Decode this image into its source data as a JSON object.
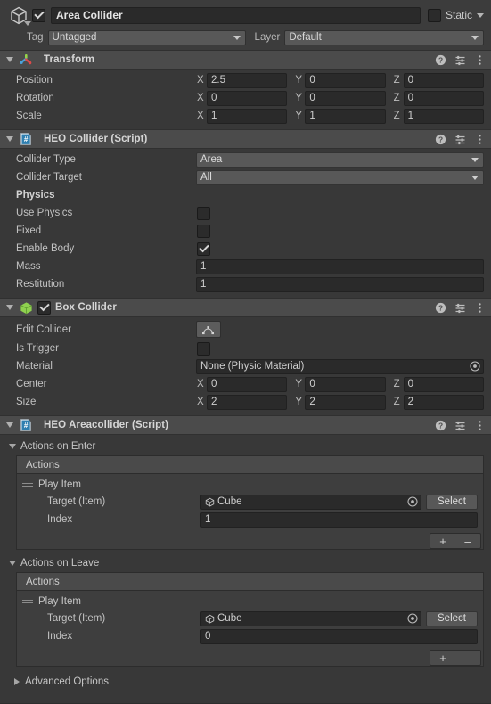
{
  "gameobject": {
    "icon": "cube-gameobject-icon",
    "enabled": true,
    "name": "Area Collider",
    "static_label": "Static",
    "tag_label": "Tag",
    "tag_value": "Untagged",
    "layer_label": "Layer",
    "layer_value": "Default"
  },
  "components": [
    {
      "title": "Transform",
      "icon": "transform-axis-icon",
      "rows": [
        {
          "label": "Position",
          "type": "vector3",
          "x": "2.5",
          "y": "0",
          "z": "0"
        },
        {
          "label": "Rotation",
          "type": "vector3",
          "x": "0",
          "y": "0",
          "z": "0"
        },
        {
          "label": "Scale",
          "type": "vector3",
          "x": "1",
          "y": "1",
          "z": "1"
        }
      ]
    },
    {
      "title": "HEO Collider (Script)",
      "icon": "csharp-script-icon",
      "rows": [
        {
          "label": "Collider Type",
          "type": "dropdown",
          "value": "Area"
        },
        {
          "label": "Collider Target",
          "type": "dropdown",
          "value": "All"
        },
        {
          "label": "Physics",
          "type": "header"
        },
        {
          "label": "Use Physics",
          "type": "checkbox",
          "checked": false
        },
        {
          "label": "Fixed",
          "type": "checkbox",
          "checked": false
        },
        {
          "label": "Enable Body",
          "type": "checkbox",
          "checked": true
        },
        {
          "label": "Mass",
          "type": "text",
          "value": "1"
        },
        {
          "label": "Restitution",
          "type": "text",
          "value": "1"
        }
      ]
    },
    {
      "title": "Box Collider",
      "icon": "box-collider-icon",
      "enabled": true,
      "rows": [
        {
          "label": "Edit Collider",
          "type": "editbutton"
        },
        {
          "label": "Is Trigger",
          "type": "checkbox",
          "checked": false
        },
        {
          "label": "Material",
          "type": "object",
          "value": "None (Physic Material)"
        },
        {
          "label": "Center",
          "type": "vector3",
          "x": "0",
          "y": "0",
          "z": "0"
        },
        {
          "label": "Size",
          "type": "vector3",
          "x": "2",
          "y": "2",
          "z": "2"
        }
      ]
    }
  ],
  "areacollider": {
    "title": "HEO Areacollider (Script)",
    "icon": "csharp-script-icon",
    "sections": [
      {
        "fold_label": "Actions on Enter",
        "list_header": "Actions",
        "item_title": "Play Item",
        "target_label": "Target (Item)",
        "target_value": "Cube",
        "select_label": "Select",
        "index_label": "Index",
        "index_value": "1",
        "add_label": "+",
        "remove_label": "–"
      },
      {
        "fold_label": "Actions on Leave",
        "list_header": "Actions",
        "item_title": "Play Item",
        "target_label": "Target (Item)",
        "target_value": "Cube",
        "select_label": "Select",
        "index_label": "Index",
        "index_value": "0",
        "add_label": "+",
        "remove_label": "–"
      }
    ],
    "advanced_label": "Advanced Options"
  },
  "header_icons": {
    "help": "help-icon",
    "preset": "preset-icon",
    "menu": "more-menu-icon"
  },
  "colors": {
    "panel_bg": "#383838",
    "header_bg": "#4b4b4b",
    "field_bg": "#2a2a2a",
    "dropdown_bg": "#585858",
    "text": "#c4c4c4",
    "collider_green": "#8fd14f",
    "script_blue": "#3a7fa8"
  }
}
